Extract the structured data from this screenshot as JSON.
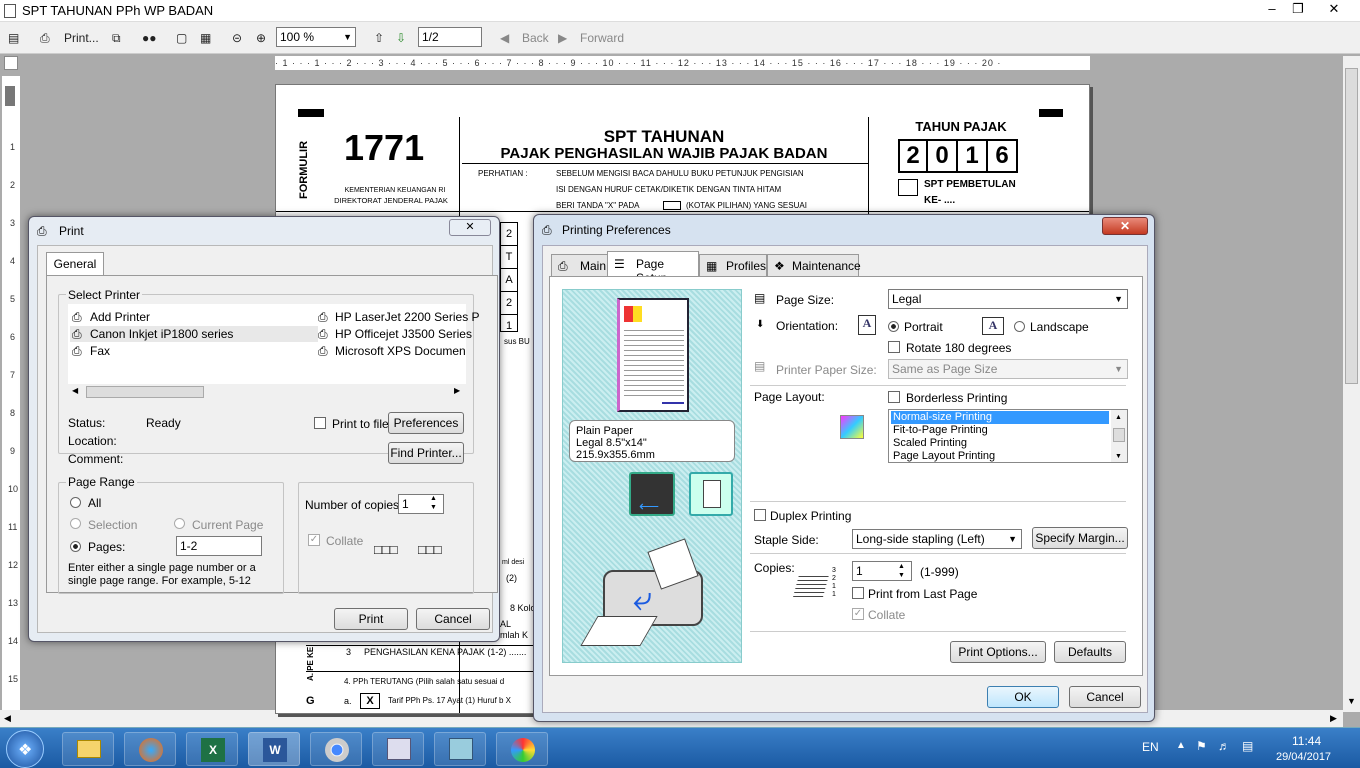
{
  "app": {
    "title": "SPT TAHUNAN PPh WP BADAN"
  },
  "toolbar": {
    "print": "Print...",
    "zoom": "100 %",
    "page": "1/2",
    "back": "Back",
    "forward": "Forward"
  },
  "ruler": "· 1 · · · 1 · · · 2 · · · 3 · · · 4 · · · 5 · · · 6 · · · 7 · · · 8 · · · 9 · · · 10 · · · 11 · · · 12 · · · 13 · · · 14 · · · 15 · · · 16 · · · 17 · · · 18 · · · 19 · · · 20 ·",
  "vruler": [
    "1",
    "2",
    "3",
    "4",
    "5",
    "6",
    "7",
    "8",
    "9",
    "10",
    "11",
    "12",
    "13",
    "14",
    "15"
  ],
  "document": {
    "formulir": "FORMULIR",
    "number": "1771",
    "ministry1": "KEMENTERIAN KEUANGAN RI",
    "ministry2": "DIREKTORAT JENDERAL PAJAK",
    "title1": "SPT TAHUNAN",
    "title2": "PAJAK PENGHASILAN WAJIB PAJAK BADAN",
    "perhatian": "PERHATIAN  :",
    "note1": "SEBELUM MENGISI BACA DAHULU BUKU PETUNJUK PENGISIAN",
    "note2": "ISI DENGAN HURUF CETAK/DIKETIK DENGAN TINTA HITAM",
    "note3a": "BERI TANDA \"X\" PADA",
    "note3b": "(KOTAK PILIHAN) YANG SESUAI",
    "tahun_label": "TAHUN PAJAK",
    "year": [
      "2",
      "0",
      "1",
      "6"
    ],
    "pembetulan": "SPT PEMBETULAN",
    "ke": "KE- ....",
    "grid": [
      "2",
      "T",
      "A",
      "2",
      "1"
    ],
    "snip1": "sus BU",
    "snip2": "ml desi",
    "snip3": "(2)",
    "snip4": "8 Kolor",
    "snip5": "AL",
    "snip6": "mlah K",
    "section_a": "A. PE KE",
    "row3_num": "3",
    "row3": "PENGHASILAN KENA PAJAK  (1-2)  .......",
    "row4": "4. PPh TERUTANG (Pilih salah satu sesuai d",
    "row_a": "a.",
    "row_a_x": "X",
    "row_a_text": "Tarif PPh Ps. 17 Ayat (1) Huruf b X",
    "section_g": "G"
  },
  "print_dialog": {
    "title": "Print",
    "tab": "General",
    "select_printer": "Select Printer",
    "printers_left": [
      "Add Printer",
      "Canon Inkjet iP1800 series",
      "Fax"
    ],
    "printers_right": [
      "HP LaserJet 2200 Series P",
      "HP Officejet J3500 Series",
      "Microsoft XPS Documen"
    ],
    "status_label": "Status:",
    "status_value": "Ready",
    "location_label": "Location:",
    "comment_label": "Comment:",
    "print_to_file": "Print to file",
    "preferences": "Preferences",
    "find_printer": "Find Printer...",
    "page_range": "Page Range",
    "all": "All",
    "selection": "Selection",
    "current_page": "Current Page",
    "pages": "Pages:",
    "pages_value": "1-2",
    "range_hint": "Enter either a single page number or a single page range.  For example, 5-12",
    "copies_label": "Number of copies:",
    "copies_value": "1",
    "collate": "Collate",
    "print_btn": "Print",
    "cancel_btn": "Cancel"
  },
  "prefs_dialog": {
    "title": "Printing Preferences",
    "tabs": [
      "Main",
      "Page Setup",
      "Profiles",
      "Maintenance"
    ],
    "preview_line1": "Plain Paper",
    "preview_line2": "Legal 8.5\"x14\" 215.9x355.6mm",
    "page_size_label": "Page Size:",
    "page_size_value": "Legal",
    "orientation_label": "Orientation:",
    "portrait": "Portrait",
    "landscape": "Landscape",
    "rotate": "Rotate 180 degrees",
    "paper_size_label": "Printer Paper Size:",
    "paper_size_value": "Same as Page Size",
    "layout_label": "Page Layout:",
    "borderless": "Borderless Printing",
    "layouts": [
      "Normal-size Printing",
      "Fit-to-Page Printing",
      "Scaled Printing",
      "Page Layout Printing"
    ],
    "duplex": "Duplex Printing",
    "staple_label": "Staple Side:",
    "staple_value": "Long-side stapling (Left)",
    "specify_margin": "Specify Margin...",
    "copies_label": "Copies:",
    "copies_value": "1",
    "copies_range": "(1-999)",
    "print_last": "Print from Last Page",
    "collate": "Collate",
    "print_options": "Print Options...",
    "defaults": "Defaults",
    "ok": "OK",
    "cancel": "Cancel"
  },
  "taskbar": {
    "lang": "EN",
    "time": "11:44",
    "date": "29/04/2017"
  }
}
